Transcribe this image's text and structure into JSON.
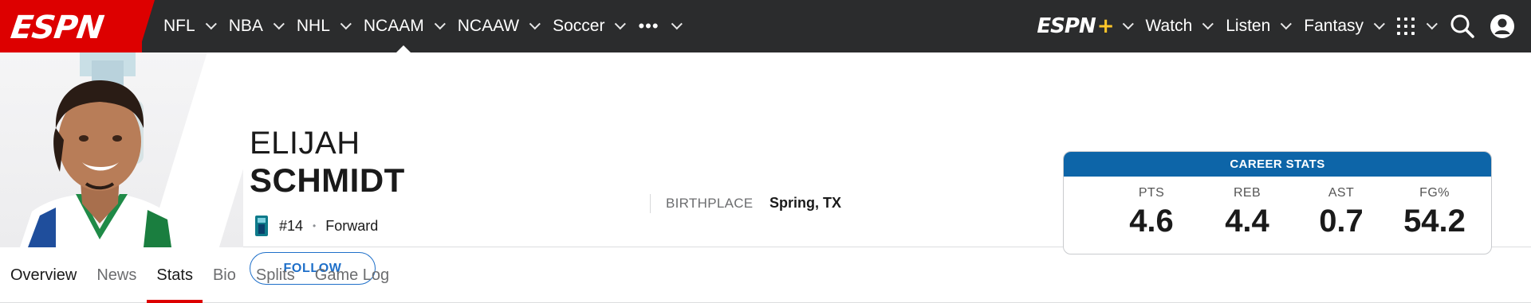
{
  "nav": {
    "logo": "ESPN",
    "left_items": [
      {
        "label": "NFL"
      },
      {
        "label": "NBA"
      },
      {
        "label": "NHL"
      },
      {
        "label": "NCAAM",
        "active": true
      },
      {
        "label": "NCAAW"
      },
      {
        "label": "Soccer"
      }
    ],
    "more_label": "•••",
    "espn_plus": {
      "text": "ESPN",
      "plus": "+"
    },
    "right_items": [
      {
        "label": "Watch"
      },
      {
        "label": "Listen"
      },
      {
        "label": "Fantasy"
      }
    ],
    "icons": [
      "grid-icon",
      "search-icon",
      "profile-icon"
    ],
    "colors": {
      "bar": "#2b2c2d",
      "brand": "#dd0000",
      "plus": "#ffc629"
    }
  },
  "player": {
    "first_name": "ELIJAH",
    "last_name": "SCHMIDT",
    "number": "#14",
    "separator": "•",
    "position": "Forward",
    "follow_label": "FOLLOW",
    "birthplace_label": "BIRTHPLACE",
    "birthplace_value": "Spring, TX"
  },
  "career_stats": {
    "title": "CAREER STATS",
    "accent": "#0d65a8",
    "items": [
      {
        "label": "PTS",
        "value": "4.6"
      },
      {
        "label": "REB",
        "value": "4.4"
      },
      {
        "label": "AST",
        "value": "0.7"
      },
      {
        "label": "FG%",
        "value": "54.2"
      }
    ]
  },
  "tabs": [
    {
      "label": "Overview"
    },
    {
      "label": "News"
    },
    {
      "label": "Stats",
      "active": true
    },
    {
      "label": "Bio"
    },
    {
      "label": "Splits"
    },
    {
      "label": "Game Log"
    }
  ]
}
